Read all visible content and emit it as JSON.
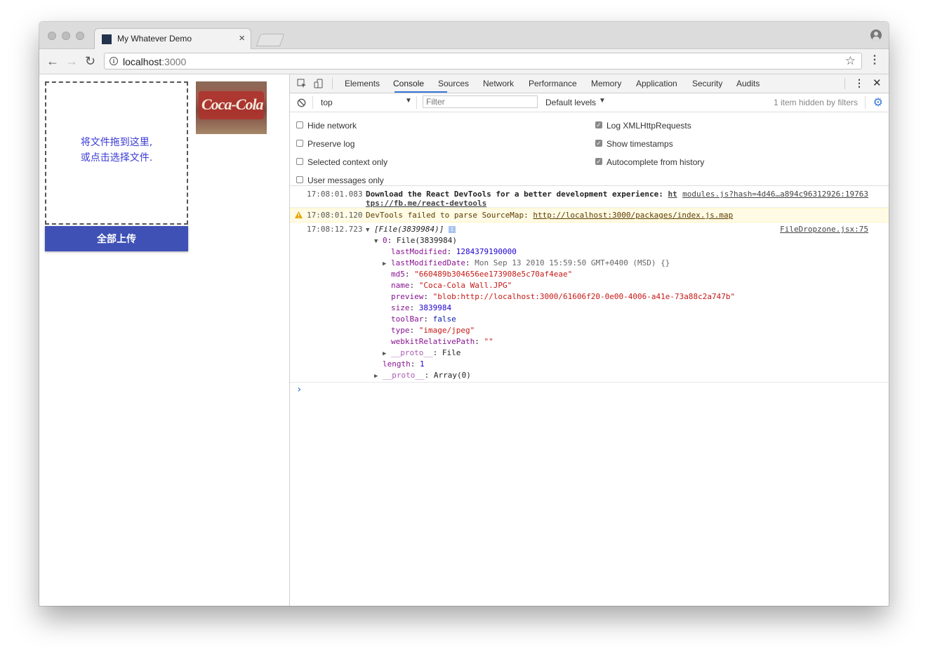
{
  "window": {
    "tab_title": "My Whatever Demo",
    "tab_close": "×",
    "url_host": "localhost",
    "url_port": ":3000"
  },
  "app": {
    "dropzone_line1": "将文件拖到这里,",
    "dropzone_line2": "或点击选择文件.",
    "thumb_text": "Coca-Cola",
    "upload_button": "全部上传"
  },
  "devtools": {
    "tabs": [
      "Elements",
      "Console",
      "Sources",
      "Network",
      "Performance",
      "Memory",
      "Application",
      "Security",
      "Audits"
    ],
    "active_tab": "Console",
    "context": "top",
    "filter_placeholder": "Filter",
    "levels": "Default levels",
    "hidden_note": "1 item hidden by filters",
    "settings_left": [
      "Hide network",
      "Preserve log",
      "Selected context only",
      "User messages only"
    ],
    "settings_right": [
      "Log XMLHttpRequests",
      "Show timestamps",
      "Autocomplete from history"
    ],
    "settings_right_checked": [
      true,
      true,
      true
    ]
  },
  "console": {
    "msg1_time": "17:08:01.083",
    "msg1_text": "Download the React DevTools for a better development experience:",
    "msg1_link_a": "ht",
    "msg1_link_b": "tps://fb.me/react-devtools",
    "msg1_source": "modules.js?hash=4d46…a894c96312926:19763",
    "msg2_time": "17:08:01.120",
    "msg2_text": "DevTools failed to parse SourceMap:",
    "msg2_link": "http://localhost:3000/packages/index.js.map",
    "msg3_time": "17:08:12.723",
    "msg3_summary": "[File(3839984)]",
    "msg3_source": "FileDropzone.jsx:75",
    "item0": "File(3839984)",
    "props": {
      "lastModified": "1284379190000",
      "lastModifiedDate": "Mon Sep 13 2010 15:59:50 GMT+0400 (MSD) {}",
      "md5": "\"660489b304656ee173908e5c70af4eae\"",
      "name": "\"Coca-Cola Wall.JPG\"",
      "preview": "\"blob:http://localhost:3000/61606f20-0e00-4006-a41e-73a88c2a747b\"",
      "size": "3839984",
      "toolBar": "false",
      "type": "\"image/jpeg\"",
      "webkitRelativePath": "\"\"",
      "proto_inner": "File",
      "length": "1",
      "proto_outer": "Array(0)"
    },
    "prompt": "›"
  }
}
